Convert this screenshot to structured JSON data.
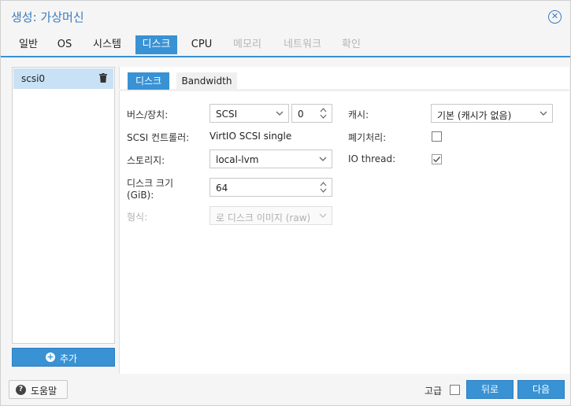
{
  "window": {
    "title": "생성: 가상머신"
  },
  "tabs": [
    {
      "label": "일반",
      "state": "normal"
    },
    {
      "label": "OS",
      "state": "normal"
    },
    {
      "label": "시스템",
      "state": "normal"
    },
    {
      "label": "디스크",
      "state": "active"
    },
    {
      "label": "CPU",
      "state": "normal"
    },
    {
      "label": "메모리",
      "state": "disabled"
    },
    {
      "label": "네트워크",
      "state": "disabled"
    },
    {
      "label": "확인",
      "state": "disabled"
    }
  ],
  "disks": {
    "items": [
      {
        "label": "scsi0"
      }
    ],
    "add_label": "추가"
  },
  "subtabs": [
    {
      "label": "디스크"
    },
    {
      "label": "Bandwidth"
    }
  ],
  "form": {
    "bus_label": "버스/장치:",
    "bus_value": "SCSI",
    "device_value": "0",
    "controller_label": "SCSI 컨트롤러:",
    "controller_value": "VirtIO SCSI single",
    "storage_label": "스토리지:",
    "storage_value": "local-lvm",
    "size_label_line1": "디스크 크기",
    "size_label_line2": "(GiB):",
    "size_value": "64",
    "format_label": "형식:",
    "format_value": "로 디스크 이미지 (raw)",
    "cache_label": "캐시:",
    "cache_value": "기본 (캐시가 없음)",
    "discard_label": "폐기처리:",
    "discard_checked": false,
    "iothread_label": "IO thread:",
    "iothread_checked": true
  },
  "footer": {
    "help_label": "도움말",
    "advanced_label": "고급",
    "advanced_checked": false,
    "back_label": "뒤로",
    "next_label": "다음"
  },
  "colors": {
    "accent": "#3892d4",
    "selected_row": "#c9e1f5",
    "title": "#3a7bbf"
  },
  "icons": [
    "close-icon",
    "trash-icon",
    "plus-circle-icon",
    "chevron-down-icon",
    "spinner-icon",
    "help-icon",
    "check-icon"
  ]
}
